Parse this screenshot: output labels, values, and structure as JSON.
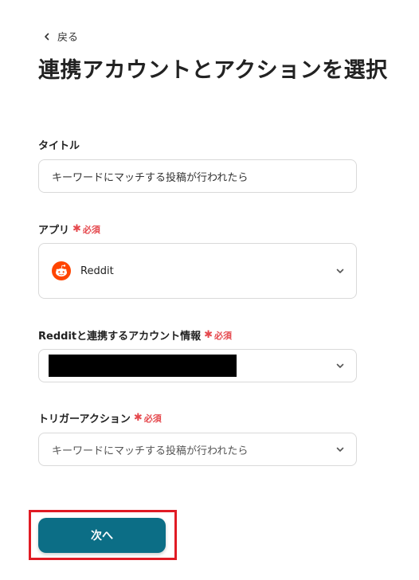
{
  "back": {
    "label": "戻る"
  },
  "page": {
    "title": "連携アカウントとアクションを選択"
  },
  "required_label": "必須",
  "title_field": {
    "label": "タイトル",
    "value": "キーワードにマッチする投稿が行われたら"
  },
  "app_field": {
    "label": "アプリ",
    "value": "Reddit",
    "icon": "reddit-icon"
  },
  "account_field": {
    "label": "Redditと連携するアカウント情報",
    "value": "[redacted]"
  },
  "trigger_field": {
    "label": "トリガーアクション",
    "value": "キーワードにマッチする投稿が行われたら"
  },
  "next_button": {
    "label": "次へ"
  },
  "colors": {
    "primary": "#0c6e86",
    "required": "#e5484d",
    "highlight": "#e01b24",
    "reddit": "#ff4500"
  }
}
